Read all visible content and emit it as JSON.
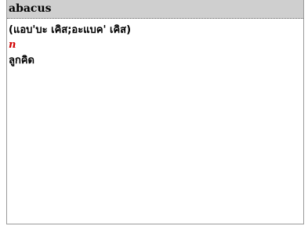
{
  "entry": {
    "headword": "abacus",
    "pronunciation": "(แอบ'บะ เคิส;อะแบค' เคิส)",
    "part_of_speech": "n",
    "translation": "ลูกคิด"
  },
  "colors": {
    "header_background": "#cfcfcf",
    "pos_color": "#d10000",
    "text_color": "#000000"
  }
}
